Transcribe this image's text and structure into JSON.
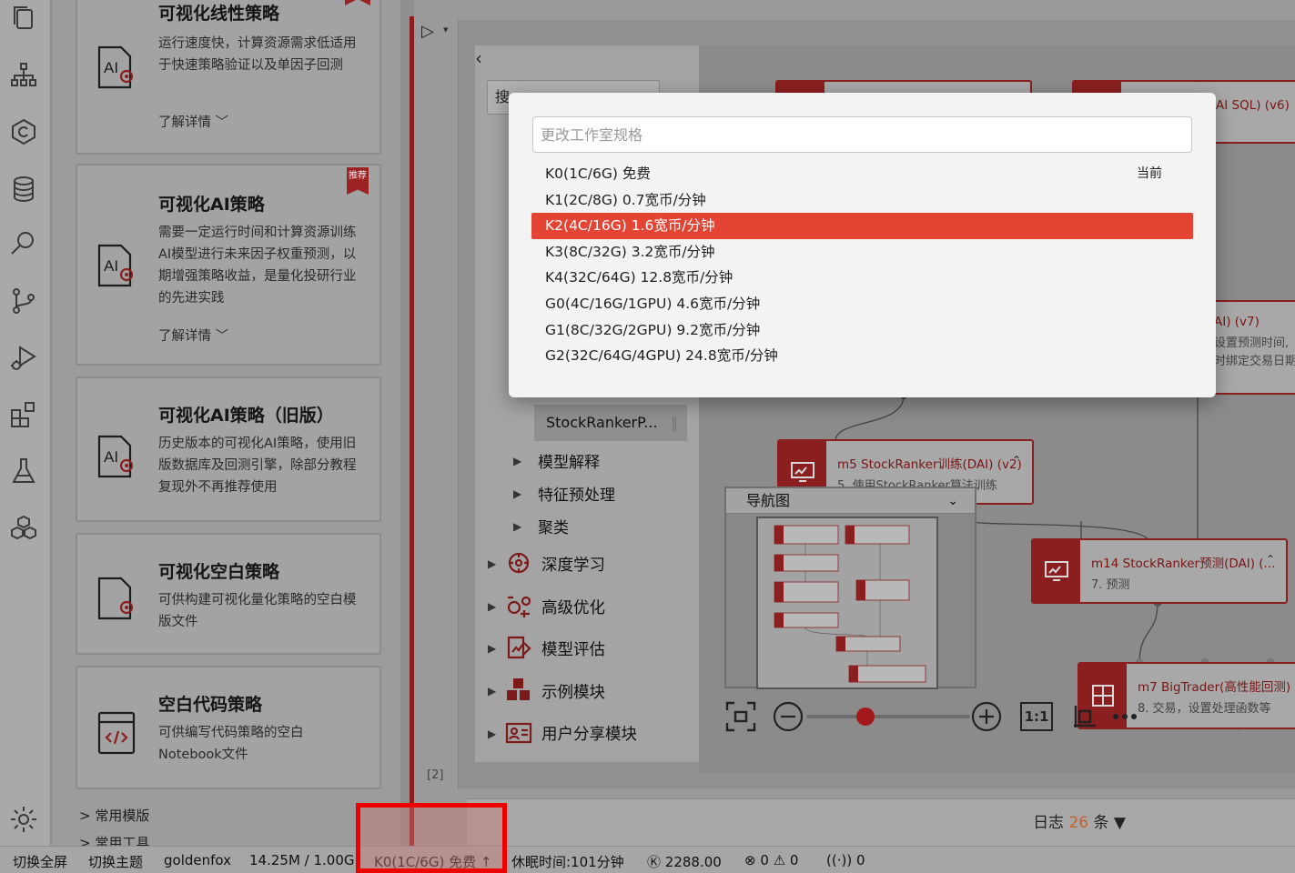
{
  "activity_bar": {
    "icons": [
      "files-icon",
      "hierarchy-icon",
      "copyright-icon",
      "database-icon",
      "search-icon",
      "git-branch-icon",
      "run-debug-icon",
      "extensions-icon",
      "flask-icon",
      "cubes-icon",
      "gear-icon"
    ]
  },
  "templates": {
    "cards": [
      {
        "title": "可视化线性策略",
        "desc": "运行速度快，计算资源需求低适用于快速策略验证以及单因子回测",
        "more": "了解详情",
        "badge": ""
      },
      {
        "title": "可视化AI策略",
        "desc": "需要一定运行时间和计算资源训练AI模型进行未来因子权重预测，以期增强策略收益，是量化投研行业的先进实践",
        "more": "了解详情",
        "badge": "推荐"
      },
      {
        "title": "可视化AI策略（旧版）",
        "desc": "历史版本的可视化AI策略，使用旧版数据库及回测引擎，除部分教程复现外不再推荐使用",
        "more": "",
        "badge": ""
      },
      {
        "title": "可视化空白策略",
        "desc": "可供构建可视化量化策略的空白模版文件",
        "more": "",
        "badge": ""
      },
      {
        "title": "空白代码策略",
        "desc": "可供编写代码策略的空白Notebook文件",
        "more": "",
        "badge": ""
      }
    ],
    "links": [
      "常用模版",
      "常用工具"
    ]
  },
  "module_tree": {
    "search_placeholder": "搜",
    "selected_item": "StockRankerP...",
    "sub_items": [
      "模型解释",
      "特征预处理",
      "聚类"
    ],
    "top_items": [
      "深度学习",
      "高级优化",
      "模型评估",
      "示例模块",
      "用户分享模块"
    ]
  },
  "toolbar": {
    "run_icon": "play-icon",
    "expand_icon": "chevron-right-icon",
    "back_icon": "chevron-left-icon"
  },
  "cell_index": "[2]",
  "flow": {
    "nodes": [
      {
        "title": "AI SQL) (v6)",
        "sub": ""
      },
      {
        "title": "AI) (v7)",
        "sub": "设置预测时间,",
        "sub2": "时绑定交易日期"
      },
      {
        "title": "m5 StockRanker训练(DAI) (v2)",
        "sub": "5. 使用StockRanker算法训练"
      },
      {
        "title": "m14 StockRanker预测(DAI) (...",
        "sub": "7. 预测"
      },
      {
        "title": "m7 BigTrader(高性能回测) (v",
        "sub": "8. 交易，设置处理函数等"
      }
    ]
  },
  "navigator": {
    "title": "导航图"
  },
  "zoom": {
    "fit_label": "1:1",
    "value": 0.25
  },
  "modal": {
    "placeholder": "更改工作室规格",
    "current_note": "当前",
    "options": [
      {
        "label": "K0(1C/6G) 免费"
      },
      {
        "label": "K1(2C/8G) 0.7宽币/分钟"
      },
      {
        "label": "K2(4C/16G) 1.6宽币/分钟"
      },
      {
        "label": "K3(8C/32G) 3.2宽币/分钟"
      },
      {
        "label": "K4(32C/64G) 12.8宽币/分钟"
      },
      {
        "label": "G0(4C/16G/1GPU) 4.6宽币/分钟"
      },
      {
        "label": "G1(8C/32G/2GPU) 9.2宽币/分钟"
      },
      {
        "label": "G2(32C/64G/4GPU) 24.8宽币/分钟"
      }
    ],
    "selected_index": 2
  },
  "log": {
    "prefix": "日志",
    "count": "26",
    "suffix": "条 ▼"
  },
  "status_bar": {
    "fullscreen": "切换全屏",
    "theme": "切换主题",
    "user": "goldenfox",
    "memory": "14.25M / 1.00G",
    "spec": "K0(1C/6G) 免费 ↑",
    "sleep": "休眠时间:101分钟",
    "credits": "2288.00",
    "errors": "0",
    "warnings": "0",
    "broadcast": "0"
  },
  "colors": {
    "accent": "#e34434",
    "brand_dark": "#8b1f1f",
    "highlight": "#ee0000"
  }
}
